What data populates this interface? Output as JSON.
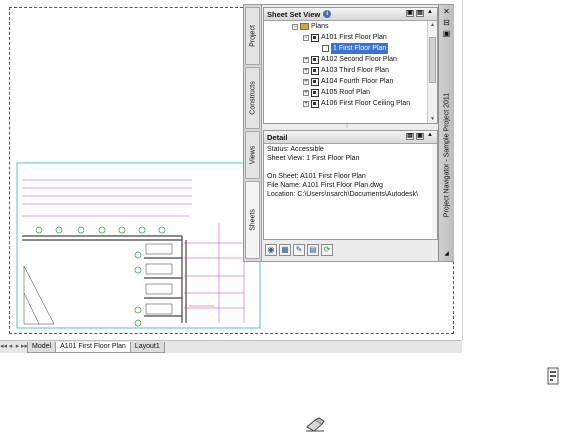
{
  "layout_tabs": {
    "nav": [
      "◂◂",
      "◂",
      "▸",
      "▸▸"
    ],
    "tabs": [
      "Model",
      "A101 First Floor Plan",
      "Layout1"
    ]
  },
  "palette": {
    "vertical_tabs": [
      "Project",
      "Constructs",
      "Views",
      "Sheets"
    ],
    "title": "Project Navigator - Sample Project 2011",
    "sheet_set_view": {
      "title": "Sheet Set View",
      "tree": [
        {
          "label": "Plans",
          "level": 0,
          "type": "folder",
          "expander": "-"
        },
        {
          "label": "A101 First Floor Plan",
          "level": 1,
          "type": "sheet",
          "expander": "-"
        },
        {
          "label": "1 First Floor Plan",
          "level": 2,
          "type": "view",
          "selected": true
        },
        {
          "label": "A102 Second Floor Plan",
          "level": 1,
          "type": "sheet",
          "expander": "+"
        },
        {
          "label": "A103 Third Floor Plan",
          "level": 1,
          "type": "sheet",
          "expander": "+"
        },
        {
          "label": "A104 Fourth Floor Plan",
          "level": 1,
          "type": "sheet",
          "expander": "+"
        },
        {
          "label": "A105 Roof Plan",
          "level": 1,
          "type": "sheet",
          "expander": "+"
        },
        {
          "label": "A106 First Floor Ceiling Plan",
          "level": 1,
          "type": "sheet",
          "expander": "+"
        }
      ]
    },
    "detail": {
      "title": "Detail",
      "lines": [
        "Status: Accessible",
        "Sheet View: 1 First Floor Plan",
        "",
        "On Sheet: A101 First Floor Plan",
        "File Name: A101 First Floor Plan.dwg",
        "Location: C:\\Users\\nsarch\\Documents\\Autodesk\\"
      ]
    },
    "toolbar_icons": [
      "sheet-set-icon",
      "new-sheet-icon",
      "add-view-icon",
      "properties-icon",
      "refresh-icon"
    ]
  },
  "colors": {
    "selection": "#3874d8",
    "drawing_magenta": "#c040c0",
    "drawing_cyan": "#30b0c8",
    "drawing_green": "#20a040"
  }
}
